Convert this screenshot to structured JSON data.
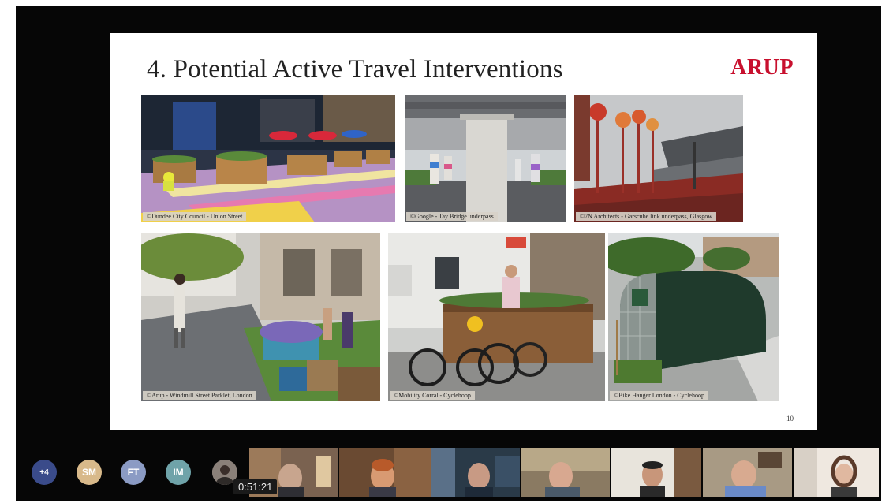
{
  "slide": {
    "title": "4. Potential Active Travel Interventions",
    "logo": "ARUP",
    "page_number": "10",
    "photos": [
      {
        "caption": "©Dundee City Council - Union Street"
      },
      {
        "caption": "©Google - Tay Bridge underpass"
      },
      {
        "caption": "©7N Architects - Garscube link underpass, Glasgow"
      },
      {
        "caption": "©Arup - Windmill Street Parklet, London"
      },
      {
        "caption": "©Mobility Corral - Cyclehoop"
      },
      {
        "caption": "©Bike Hanger London - Cyclehoop"
      }
    ],
    "colors": {
      "logo": "#c8102e",
      "title": "#222222"
    }
  },
  "participants": {
    "more_label": "+4",
    "avatars": [
      "SM",
      "FT",
      "IM"
    ],
    "video_tile_count": 7
  },
  "call": {
    "timer": "0:51:21"
  }
}
